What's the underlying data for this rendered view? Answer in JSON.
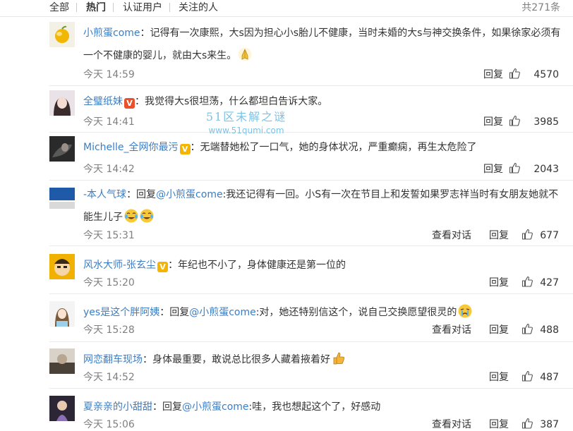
{
  "filters": {
    "all": "全部",
    "hot": "热门",
    "verified": "认证用户",
    "following": "关注的人",
    "total": "共271条"
  },
  "watermark": {
    "line1": "51区未解之谜",
    "line2": "www.51qumi.com"
  },
  "labels": {
    "reply": "回复",
    "view_conversation": "查看对话"
  },
  "comments": [
    {
      "user": "小煎蛋come",
      "text": "：记得有一次康熙，大s因为担心小s胎儿不健康，当时未婚的大s与神交换条件，如果徐家必须有一个不健康的婴儿，就由大s来生。",
      "emoji": "pray-emoji",
      "time": "今天 14:59",
      "likes": "4570"
    },
    {
      "user": "全璧纸妹",
      "badge": "red",
      "text": "：我觉得大s很坦荡，什么都坦白告诉大家。",
      "time": "今天 14:41",
      "likes": "3985"
    },
    {
      "user": "Michelle_全网你最污",
      "badge": "gold",
      "text": "：无端替她松了一口气，她的身体状况，严重癫痫，再生太危险了",
      "time": "今天 14:42",
      "likes": "2043"
    },
    {
      "user": "-本人气球",
      "prefix": "：回复",
      "mention": "@小煎蛋come",
      "text": ":我还记得有一回。小S有一次在节目上和发誓如果罗志祥当时有女朋友她就不能生儿子",
      "emoji": "laugh-cry-emoji",
      "time": "今天 15:31",
      "likes": "677",
      "has_conversation": true
    },
    {
      "user": "风水大师-张玄尘",
      "badge": "gold",
      "text": "：年纪也不小了，身体健康还是第一位的",
      "time": "今天 15:20",
      "likes": "427"
    },
    {
      "user": "yes是这个胖阿姨",
      "prefix": "：回复",
      "mention": "@小煎蛋come",
      "text": ":对，她还特别信这个，说自己交换愿望很灵的",
      "emoji": "cry-emoji",
      "time": "今天 15:28",
      "likes": "488",
      "has_conversation": true
    },
    {
      "user": "网恋翻车现场",
      "text": "：身体最重要，敢说总比很多人藏着掖着好",
      "emoji": "thumbs-up-emoji",
      "time": "今天 14:52",
      "likes": "487"
    },
    {
      "user": "夏亲亲的小甜甜",
      "prefix": "：回复",
      "mention": "@小煎蛋come",
      "text": ":哇，我也想起这个了，好感动",
      "time": "今天 15:06",
      "likes": "387",
      "has_conversation": true
    }
  ]
}
